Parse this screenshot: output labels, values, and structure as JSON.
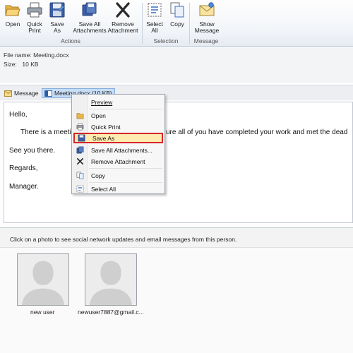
{
  "ribbon": {
    "buttons": [
      {
        "label": "Open",
        "icon": "folder-open-icon"
      },
      {
        "label": "Quick\nPrint",
        "icon": "printer-icon"
      },
      {
        "label": "Save\nAs",
        "icon": "floppy-disk-icon"
      },
      {
        "label": "Save All\nAttachments",
        "icon": "save-all-attachments-icon"
      },
      {
        "label": "Remove\nAttachment",
        "icon": "remove-x-icon"
      },
      {
        "label": "Select\nAll",
        "icon": "select-all-icon"
      },
      {
        "label": "Copy",
        "icon": "copy-icon"
      },
      {
        "label": "Show\nMessage",
        "icon": "envelope-icon"
      }
    ],
    "groups": [
      "Actions",
      "Selection",
      "Message"
    ]
  },
  "attachment_info": {
    "file_name_key": "File name:",
    "file_name": "Meeting.docx",
    "size_key": "Size:",
    "size": "10 KB"
  },
  "attachment_bar": {
    "message_tab": "Message",
    "attachment_tab": "Meeting.docx (10 KB)"
  },
  "message": {
    "lines": [
      "Hello,",
      "There is a meeting tomorrow. Please make sure all of you have completed your work and met the deadline.",
      "See you there.",
      "Regards,",
      "Manager."
    ],
    "visible_line2_left": "There is a meeti",
    "visible_line2_right": "ure all of you have completed your work and met the dead"
  },
  "people_pane": {
    "hint": "Click on a photo to see social network updates and email messages from this person.",
    "people": [
      {
        "name": "new user"
      },
      {
        "name": "newuser7887@gmail.c..."
      }
    ]
  },
  "context_menu": {
    "items": [
      {
        "label": "Preview",
        "icon": ""
      },
      {
        "label": "Open",
        "icon": "folder-open-icon"
      },
      {
        "label": "Quick Print",
        "icon": "printer-icon"
      },
      {
        "label": "Save As",
        "icon": "floppy-disk-icon",
        "highlighted": true
      },
      {
        "label": "Save All Attachments...",
        "icon": "save-all-attachments-icon"
      },
      {
        "label": "Remove Attachment",
        "icon": "remove-x-icon"
      },
      {
        "label": "Copy",
        "icon": "copy-icon"
      },
      {
        "label": "Select All",
        "icon": "select-all-icon"
      }
    ]
  },
  "colors": {
    "highlight_border": "#d6252b",
    "highlight_fill": "#fdebb0",
    "selected_tab": "#c6ddf6"
  }
}
